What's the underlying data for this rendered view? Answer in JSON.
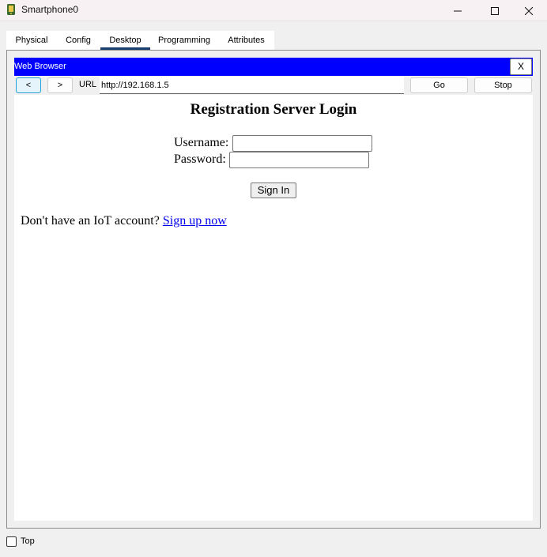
{
  "window": {
    "title": "Smartphone0",
    "controls": {
      "minimize_icon": "minimize-icon",
      "maximize_icon": "maximize-icon",
      "close_icon": "close-icon"
    }
  },
  "tabs": [
    {
      "label": "Physical",
      "active": false
    },
    {
      "label": "Config",
      "active": false
    },
    {
      "label": "Desktop",
      "active": true
    },
    {
      "label": "Programming",
      "active": false
    },
    {
      "label": "Attributes",
      "active": false
    }
  ],
  "browser": {
    "title": "Web Browser",
    "close_label": "X",
    "back_label": "<",
    "forward_label": ">",
    "url_label": "URL",
    "url_value": "http://192.168.1.5",
    "go_label": "Go",
    "stop_label": "Stop",
    "bar_color": "#0000ff"
  },
  "page": {
    "heading": "Registration Server Login",
    "username_label": "Username:",
    "username_value": "",
    "password_label": "Password:",
    "password_value": "",
    "signin_label": "Sign In",
    "signup_prompt": "Don't have an IoT account? ",
    "signup_link": "Sign up now",
    "link_color": "#0000ee"
  },
  "footer": {
    "top_label": "Top",
    "top_checked": false
  }
}
